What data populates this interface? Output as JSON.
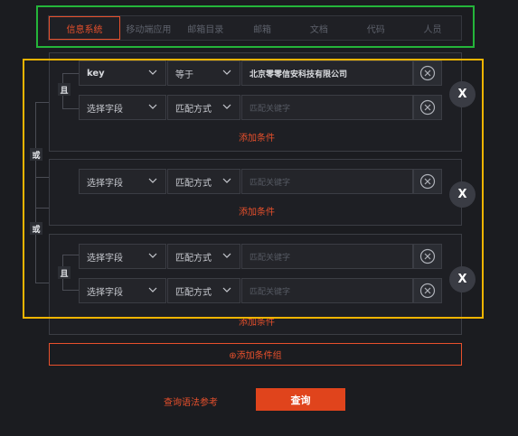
{
  "tabs": [
    "信息系统",
    "移动端应用",
    "邮箱目录",
    "邮箱",
    "文档",
    "代码",
    "人员"
  ],
  "logic": {
    "and": "且",
    "or": "或"
  },
  "groups": [
    {
      "rows": [
        {
          "field": "key",
          "operator": "等于",
          "value": "北京零零信安科技有限公司",
          "placeholder": ""
        },
        {
          "field": "选择字段",
          "operator": "匹配方式",
          "value": "",
          "placeholder": "匹配关键字"
        }
      ],
      "add_condition": "添加条件"
    },
    {
      "rows": [
        {
          "field": "选择字段",
          "operator": "匹配方式",
          "value": "",
          "placeholder": "匹配关键字"
        }
      ],
      "add_condition": "添加条件"
    },
    {
      "rows": [
        {
          "field": "选择字段",
          "operator": "匹配方式",
          "value": "",
          "placeholder": "匹配关键字"
        },
        {
          "field": "选择字段",
          "operator": "匹配方式",
          "value": "",
          "placeholder": "匹配关键字"
        }
      ],
      "add_condition": "添加条件"
    }
  ],
  "remove_group_label": "X",
  "add_group_label": "⊕添加条件组",
  "syntax_link": "查询语法参考",
  "query_button": "查询",
  "colors": {
    "accent": "#e8502c",
    "tabs_highlight": "#24b53a",
    "groups_highlight": "#f0b400"
  }
}
